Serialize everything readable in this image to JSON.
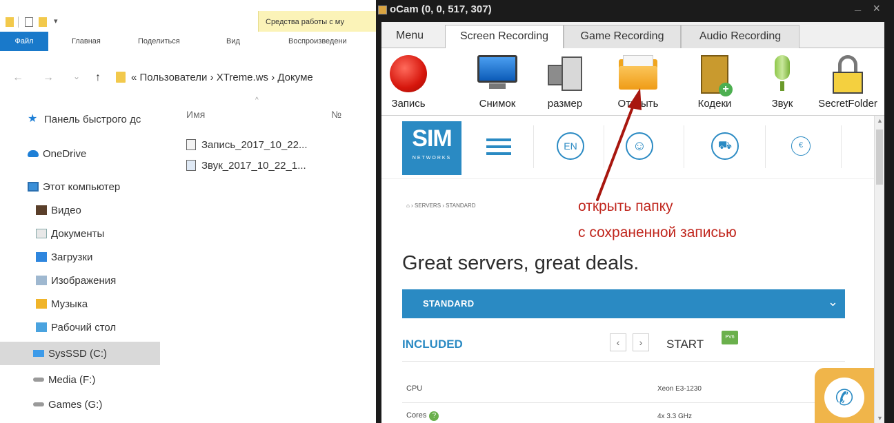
{
  "explorer": {
    "ribbon_context": "Средства работы с му",
    "tabs": {
      "file": "Файл",
      "home": "Главная",
      "share": "Поделиться",
      "view": "Вид",
      "play": "Воспроизведени"
    },
    "nav_back": "←",
    "nav_forward": "→",
    "nav_dropdown": "⌄",
    "nav_up": "↑",
    "address": "« Пользователи › XTreme.ws › Докуме",
    "nav_items": [
      {
        "label": "Панель быстрого дс",
        "icon": "star-icon"
      },
      {
        "label": "OneDrive",
        "icon": "cloud-icon"
      },
      {
        "label": "Этот компьютер",
        "icon": "computer-icon"
      },
      {
        "label": "Видео",
        "icon": "video-folder-icon"
      },
      {
        "label": "Документы",
        "icon": "documents-folder-icon"
      },
      {
        "label": "Загрузки",
        "icon": "downloads-folder-icon"
      },
      {
        "label": "Изображения",
        "icon": "pictures-folder-icon"
      },
      {
        "label": "Музыка",
        "icon": "music-folder-icon"
      },
      {
        "label": "Рабочий стол",
        "icon": "desktop-folder-icon"
      },
      {
        "label": "SysSSD (C:)",
        "icon": "drive-icon"
      },
      {
        "label": "Media (F:)",
        "icon": "drive-icon"
      },
      {
        "label": "Games (G:)",
        "icon": "drive-icon"
      }
    ],
    "columns": {
      "name": "Имя",
      "number": "№"
    },
    "files": [
      {
        "name": "Запись_2017_10_22..."
      },
      {
        "name": "Звук_2017_10_22_1..."
      }
    ]
  },
  "ocam": {
    "title": "oCam (0, 0, 517, 307)",
    "close": "×",
    "minimize": "_",
    "tabs": [
      "Menu",
      "Screen Recording",
      "Game Recording",
      "Audio Recording"
    ],
    "tools": [
      "Запись",
      "Снимок",
      "размер",
      "Открыть",
      "Кодеки",
      "Звук",
      "SecretFolder"
    ]
  },
  "site": {
    "logo": "SIM",
    "logo_sub": "NETWORKS",
    "lang": "EN",
    "currency": "€",
    "breadcrumbs": "⌂  ›  SERVERS  ›  STANDARD",
    "headline": "Great servers, great deals.",
    "plan": "STANDARD",
    "included": "INCLUDED",
    "start": "START",
    "pvt_badge": "PV6",
    "specs": [
      {
        "label": "CPU",
        "value": "Xeon E3-1230"
      },
      {
        "label": "Cores",
        "value": "4x 3.3 GHz"
      }
    ]
  },
  "annotation": {
    "line1": "открыть папку",
    "line2": "с сохраненной записью",
    "color": "#c0261d"
  }
}
